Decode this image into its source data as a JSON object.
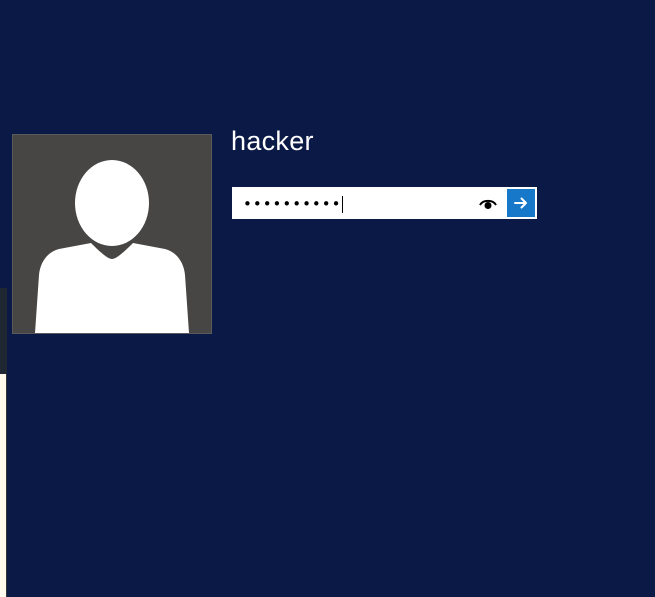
{
  "account": {
    "username": "hacker",
    "avatar_icon": "user-silhouette-icon"
  },
  "password": {
    "masked_value": "••••••••••",
    "reveal_icon": "eye-icon",
    "submit_icon": "arrow-right-icon"
  },
  "colors": {
    "background": "#0a1946",
    "avatar_background": "#474645",
    "submit_accent": "#1777c9"
  }
}
